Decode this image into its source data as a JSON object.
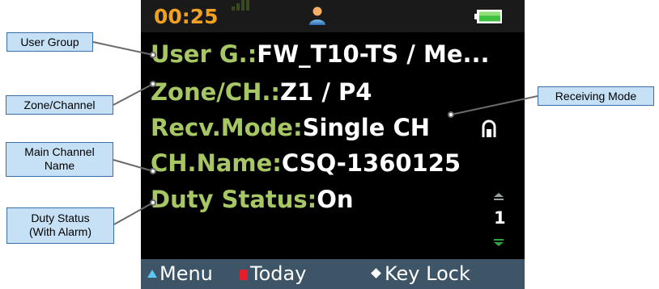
{
  "statusbar": {
    "time": "00:25",
    "signal": "signal-bars-icon",
    "user": "user-icon",
    "battery": "battery-icon",
    "colors": {
      "time": "#f2a11f",
      "battery": "#3fc03f"
    }
  },
  "fields": {
    "user_group": {
      "label": "User G.:",
      "value": "FW_T10-TS / Me..."
    },
    "zone_channel": {
      "label": "Zone/CH.:",
      "value": "Z1 / P4"
    },
    "recv_mode": {
      "label": "Recv.Mode:",
      "value": "Single CH"
    },
    "ch_name": {
      "label": "CH.Name:",
      "value": "CSQ-1360125"
    },
    "duty_status": {
      "label": "Duty Status:",
      "value": "On"
    }
  },
  "indicators": {
    "ch_tag_icon": "single-channel-mode-icon",
    "page_number": "1",
    "scroll_up_icon": "scroll-up-arrow-icon",
    "scroll_down_icon": "scroll-down-arrow-icon"
  },
  "softkeys": {
    "menu": "Menu",
    "today": "Today",
    "key_lock": "Key Lock",
    "colors": {
      "menu_mark": "#5ac8f0",
      "today_mark": "#e41e2b"
    }
  },
  "callouts": {
    "user_group": "User Group",
    "zone_channel": "Zone/Channel",
    "main_channel_name": [
      "Main Channel",
      "Name"
    ],
    "duty_status": [
      "Duty Status",
      "(With Alarm)"
    ],
    "receiving_mode": "Receiving Mode"
  },
  "theme": {
    "label_color": "#a7c764",
    "value_color": "#ffffff",
    "softkey_bar": "#3d5566",
    "callout_fill": "#c6e1f5",
    "callout_border": "#3b6ea8"
  }
}
